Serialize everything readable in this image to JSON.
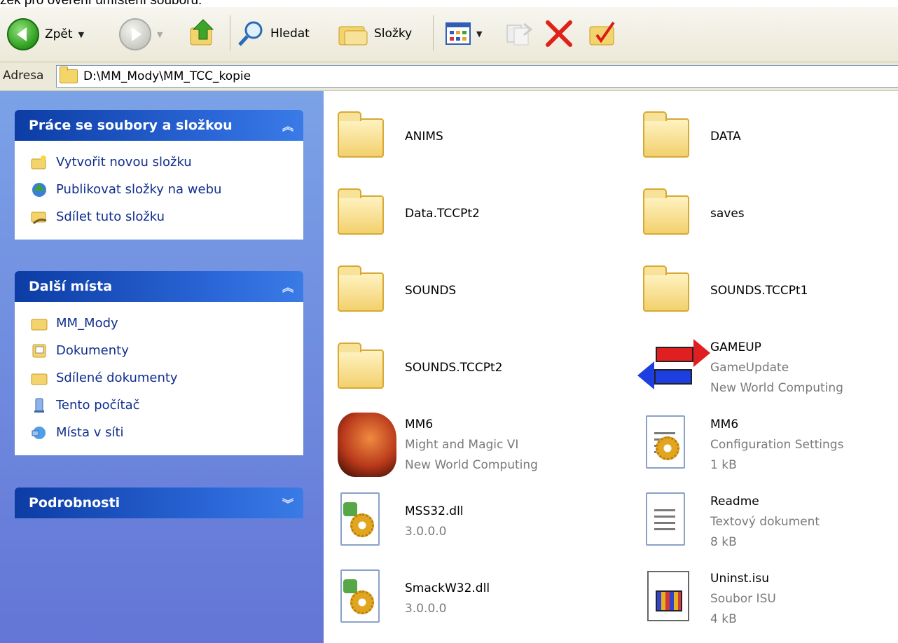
{
  "caption": "zek pro ověření umístění souboru:",
  "toolbar": {
    "back_label": "Zpět",
    "search_label": "Hledat",
    "folders_label": "Složky"
  },
  "address": {
    "label": "Adresa",
    "path": "D:\\MM_Mody\\MM_TCC_kopie"
  },
  "tasks": {
    "title": "Práce se soubory a složkou",
    "items": [
      {
        "label": "Vytvořit novou složku"
      },
      {
        "label": "Publikovat složky na webu"
      },
      {
        "label": "Sdílet tuto složku"
      }
    ]
  },
  "places": {
    "title": "Další místa",
    "items": [
      {
        "label": "MM_Mody"
      },
      {
        "label": "Dokumenty"
      },
      {
        "label": "Sdílené dokumenty"
      },
      {
        "label": "Tento počítač"
      },
      {
        "label": "Místa v síti"
      }
    ]
  },
  "details": {
    "title": "Podrobnosti"
  },
  "files": [
    {
      "name": "ANIMS",
      "icon": "folder-icon"
    },
    {
      "name": "DATA",
      "icon": "folder-icon"
    },
    {
      "name": "Data.TCCPt2",
      "icon": "folder-icon"
    },
    {
      "name": "saves",
      "icon": "folder-icon"
    },
    {
      "name": "SOUNDS",
      "icon": "folder-icon"
    },
    {
      "name": "SOUNDS.TCCPt1",
      "icon": "folder-icon"
    },
    {
      "name": "SOUNDS.TCCPt2",
      "icon": "folder-icon"
    },
    {
      "name": "GAMEUP",
      "line2": "GameUpdate",
      "line3": "New World Computing",
      "icon": "gameup-icon"
    },
    {
      "name": "MM6",
      "line2": "Might and Magic VI",
      "line3": "New World Computing",
      "icon": "dragon-icon"
    },
    {
      "name": "MM6",
      "line2": "Configuration Settings",
      "line3": "1 kB",
      "icon": "config-icon"
    },
    {
      "name": "MSS32.dll",
      "line2": "3.0.0.0",
      "icon": "dll-icon"
    },
    {
      "name": "Readme",
      "line2": "Textový dokument",
      "line3": "8 kB",
      "icon": "text-doc-icon"
    },
    {
      "name": "SmackW32.dll",
      "line2": "3.0.0.0",
      "icon": "dll-icon"
    },
    {
      "name": "Uninst.isu",
      "line2": "Soubor ISU",
      "line3": "4 kB",
      "icon": "isu-icon"
    }
  ]
}
